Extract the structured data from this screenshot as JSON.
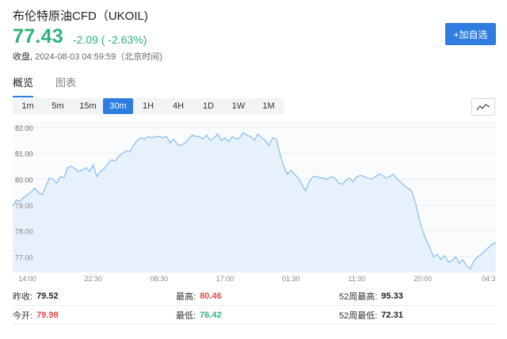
{
  "header": {
    "title": "布伦特原油CFD（UKOIL)",
    "price": "77.43",
    "change": "-2.09 ( -2.63%)",
    "close_label": "收盘,",
    "close_time": " 2024-08-03 04:59:59（北京时间)"
  },
  "watch_button": "+加自选",
  "tabs": [
    "概览",
    "图表"
  ],
  "ranges": [
    "1m",
    "5m",
    "15m",
    "30m",
    "1H",
    "4H",
    "1D",
    "1W",
    "1M"
  ],
  "active_range": "30m",
  "colors": {
    "up": "#e24a4a",
    "down": "#2fb37b",
    "accent": "#2f7de1",
    "line": "#8fc0ee",
    "area": "#e6f1fc"
  },
  "chart_data": {
    "type": "area",
    "yticks": [
      82.0,
      81.0,
      80.0,
      79.0,
      78.0,
      77.0
    ],
    "ytick_labels": [
      "82.00",
      "81.00",
      "80.00",
      "79.00",
      "78.00",
      "77.00"
    ],
    "ylim": [
      76.4,
      82.15
    ],
    "xtick_labels": [
      "14:00",
      "22:30",
      "08:30",
      "17:00",
      "01:30",
      "11:30",
      "20:00",
      "04:3"
    ],
    "xtick_index": [
      4,
      22,
      40,
      58,
      76,
      94,
      112,
      130
    ],
    "values": [
      78.95,
      79.2,
      79.15,
      79.3,
      79.4,
      79.5,
      79.65,
      79.5,
      79.4,
      79.7,
      80.05,
      80.0,
      79.85,
      80.1,
      80.05,
      80.45,
      80.5,
      80.4,
      80.3,
      80.35,
      80.45,
      80.3,
      80.55,
      80.1,
      80.3,
      80.4,
      80.6,
      80.75,
      80.7,
      80.9,
      81.0,
      81.1,
      81.05,
      81.3,
      81.5,
      81.6,
      81.55,
      81.65,
      81.6,
      81.65,
      81.65,
      81.6,
      81.65,
      81.4,
      81.55,
      81.35,
      81.3,
      81.4,
      81.55,
      81.7,
      81.65,
      81.65,
      81.55,
      81.7,
      81.5,
      81.6,
      81.75,
      81.5,
      81.6,
      81.45,
      81.65,
      81.55,
      81.6,
      81.8,
      81.7,
      81.65,
      81.5,
      81.75,
      81.6,
      81.5,
      81.3,
      81.6,
      81.55,
      81.0,
      80.5,
      80.2,
      80.35,
      80.2,
      80.05,
      79.8,
      79.55,
      79.9,
      80.1,
      80.1,
      80.05,
      80.05,
      80.0,
      80.1,
      80.05,
      79.85,
      79.8,
      79.95,
      80.05,
      79.9,
      80.1,
      80.15,
      80.1,
      80.05,
      80.0,
      80.1,
      80.2,
      80.15,
      80.05,
      80.1,
      80.2,
      80.0,
      79.9,
      79.75,
      79.65,
      79.55,
      79.1,
      78.5,
      78.0,
      77.65,
      77.35,
      77.0,
      77.1,
      76.9,
      77.05,
      76.8,
      76.85,
      77.0,
      76.75,
      76.9,
      76.65,
      76.55,
      76.85,
      77.0,
      77.1,
      77.25,
      77.35,
      77.5,
      77.55
    ]
  },
  "stats": [
    [
      {
        "label": "昨收:",
        "value": "79.52",
        "color": "dark"
      },
      {
        "label": "最高:",
        "value": "80.46",
        "color": "red"
      },
      {
        "label": "52周最高:",
        "value": "95.33",
        "color": "dark"
      }
    ],
    [
      {
        "label": "今开:",
        "value": "79.98",
        "color": "red"
      },
      {
        "label": "最低:",
        "value": "76.42",
        "color": "green"
      },
      {
        "label": "52周最低:",
        "value": "72.31",
        "color": "dark"
      }
    ]
  ]
}
